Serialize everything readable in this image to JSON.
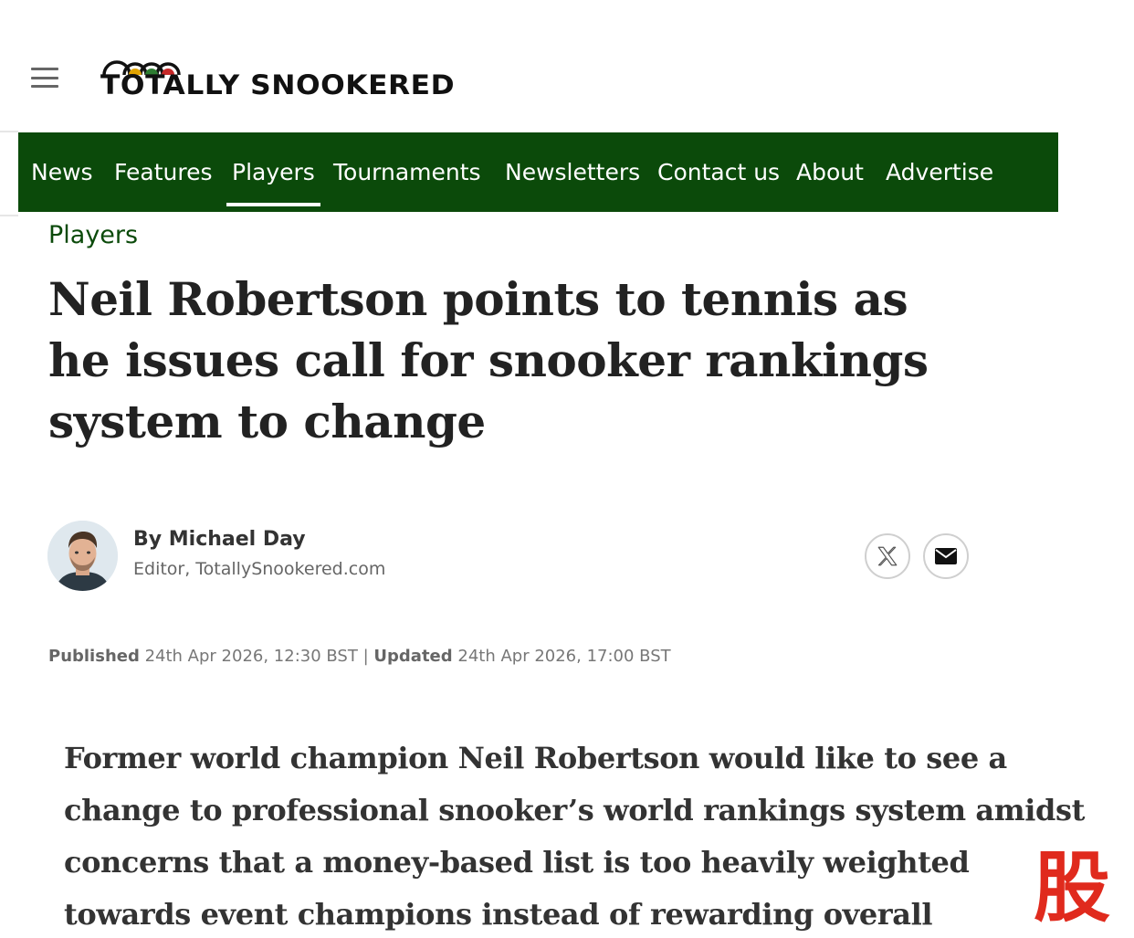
{
  "site": {
    "logo_text": "TOTALLY SNOOKERED",
    "menu_icon": "hamburger-menu-icon"
  },
  "nav": {
    "items": [
      {
        "label": "News"
      },
      {
        "label": "Features"
      },
      {
        "label": "Players",
        "active": true
      },
      {
        "label": "Tournaments"
      },
      {
        "label": "Newsletters"
      },
      {
        "label": "Contact us"
      },
      {
        "label": "About"
      },
      {
        "label": "Advertise"
      }
    ],
    "background": "#0b4a0a"
  },
  "article": {
    "category": "Players",
    "headline": "Neil Robertson points to tennis as he issues call for snooker rankings system to change",
    "author": {
      "name": "By Michael Day",
      "role": "Editor, TotallySnookered.com"
    },
    "share": {
      "x_icon": "x-social-icon",
      "email_icon": "email-icon"
    },
    "dates": {
      "published_label": "Published",
      "published_value": "24th Apr 2026, 12:30 BST",
      "separator": "|",
      "updated_label": "Updated",
      "updated_value": "24th Apr 2026, 17:00 BST"
    },
    "lead": "Former world champion Neil Robertson would like to see a change to professional snooker’s world rankings system amidst concerns that a money-based list is too heavily weighted towards event champions instead of rewarding overall"
  },
  "watermark": {
    "text": "股",
    "color": "#e02a1d"
  }
}
